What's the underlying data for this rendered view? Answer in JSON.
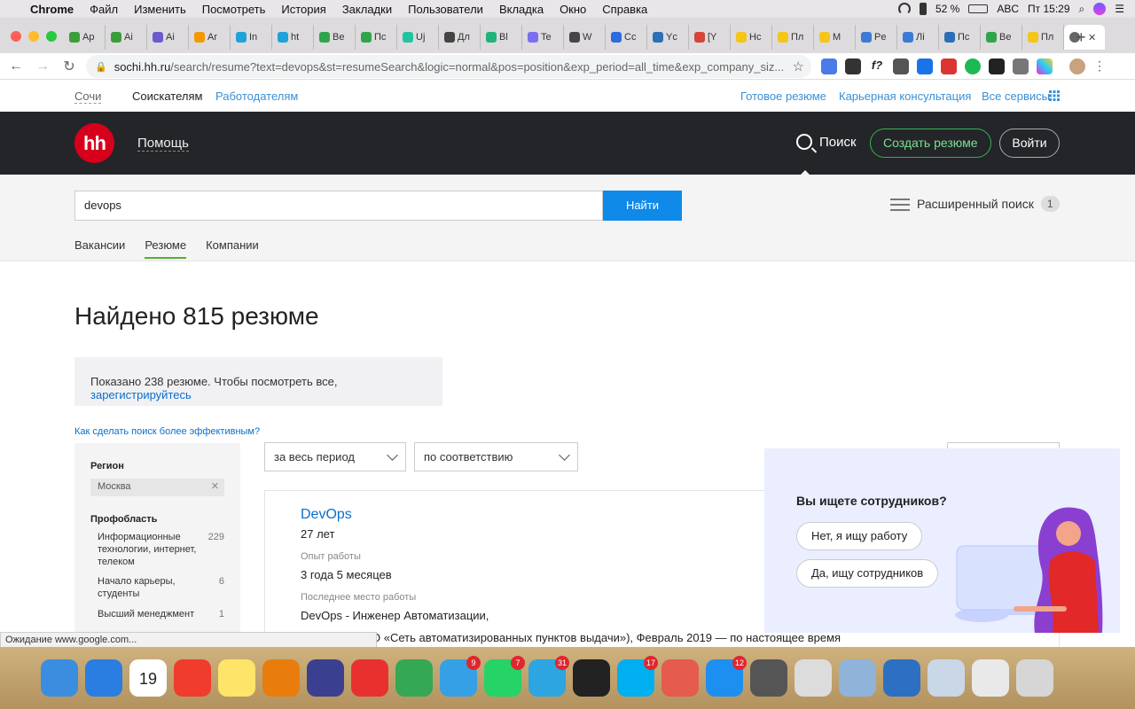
{
  "menubar": {
    "app": "Chrome",
    "items": [
      "Файл",
      "Изменить",
      "Посмотреть",
      "История",
      "Закладки",
      "Пользователи",
      "Вкладка",
      "Окно",
      "Справка"
    ],
    "battery": "52 %",
    "input_source": "ABC",
    "clock": "Пт 15:29"
  },
  "tabs": [
    {
      "label": "Ap",
      "color": "#3a9e3a"
    },
    {
      "label": "Ai",
      "color": "#3a9e3a"
    },
    {
      "label": "Ai",
      "color": "#6a5acd"
    },
    {
      "label": "Ar",
      "color": "#f29900"
    },
    {
      "label": "In",
      "color": "#1ea2d8"
    },
    {
      "label": "ht",
      "color": "#1ea2d8"
    },
    {
      "label": "Be",
      "color": "#2fa54b"
    },
    {
      "label": "Пс",
      "color": "#2fa54b"
    },
    {
      "label": "Uj",
      "color": "#22c4a0"
    },
    {
      "label": "Дл",
      "color": "#444444"
    },
    {
      "label": "Bl",
      "color": "#22b37b"
    },
    {
      "label": "Te",
      "color": "#7a6ff0"
    },
    {
      "label": "W",
      "color": "#464646"
    },
    {
      "label": "Cc",
      "color": "#2d6cdf"
    },
    {
      "label": "Yc",
      "color": "#2c6fb6"
    },
    {
      "label": "[Y",
      "color": "#d44638"
    },
    {
      "label": "Hc",
      "color": "#f5c518"
    },
    {
      "label": "Пл",
      "color": "#f5c518"
    },
    {
      "label": "M",
      "color": "#f5c518"
    },
    {
      "label": "Pe",
      "color": "#3a7bd5"
    },
    {
      "label": "Лi",
      "color": "#3a7bd5"
    },
    {
      "label": "Пс",
      "color": "#2c6fb6"
    },
    {
      "label": "Be",
      "color": "#2fa54b"
    },
    {
      "label": "Пл",
      "color": "#f5c518"
    }
  ],
  "address": {
    "host": "sochi.hh.ru",
    "path": "/search/resume?text=devops&st=resumeSearch&logic=normal&pos=position&exp_period=all_time&exp_company_siz..."
  },
  "sitenav": {
    "city": "Сочи",
    "seekers": "Соискателям",
    "employers": "Работодателям",
    "ready_resume": "Готовое резюме",
    "career": "Карьерная консультация",
    "all_services": "Все сервисы"
  },
  "header": {
    "logo": "hh",
    "help": "Помощь",
    "search": "Поиск",
    "create": "Создать резюме",
    "login": "Войти"
  },
  "search": {
    "query": "devops",
    "button": "Найти",
    "advanced": "Расширенный поиск",
    "advanced_count": "1",
    "tabs": [
      "Вакансии",
      "Резюме",
      "Компании"
    ]
  },
  "results": {
    "found": "Найдено 815 резюме",
    "notice_text": "Показано 238 резюме. Чтобы посмотреть все, ",
    "notice_link": "зарегистрируйтесь",
    "tip": "Как сделать поиск более эффективным?"
  },
  "filters": {
    "region_title": "Регион",
    "region_value": "Москва",
    "prof_title": "Профобласть",
    "prof": [
      {
        "label": "Информационные технологии, интернет, телеком",
        "count": "229"
      },
      {
        "label": "Начало карьеры, студенты",
        "count": "6"
      },
      {
        "label": "Высший менеджмент",
        "count": "1"
      }
    ]
  },
  "sort": {
    "period": "за весь период",
    "order": "по соответствию"
  },
  "resume": {
    "title": "DevOps",
    "age": "27 лет",
    "exp_label": "Опыт работы",
    "exp_value": "3 года 5 месяцев",
    "last_label": "Последнее место работы",
    "last_value": "DevOps - Инженер Автоматизации,",
    "company": "О «Сеть автоматизированных пунктов выдачи»), Февраль 2019 — по настоящее время"
  },
  "popup": {
    "title": "Вы ищете сотрудников?",
    "no": "Нет, я ищу работу",
    "yes": "Да, ищу сотрудников"
  },
  "status_bar": "Ожидание www.google.com...",
  "dock": [
    {
      "name": "finder",
      "color": "#3b8de0"
    },
    {
      "name": "safari",
      "color": "#2a7de1"
    },
    {
      "name": "calendar",
      "color": "#ffffff",
      "text": "19"
    },
    {
      "name": "anydesk",
      "color": "#ef3c2d"
    },
    {
      "name": "notes",
      "color": "#ffe46a"
    },
    {
      "name": "blender",
      "color": "#e87d0d"
    },
    {
      "name": "app-x",
      "color": "#3b3f8f"
    },
    {
      "name": "crossover",
      "color": "#e8312f"
    },
    {
      "name": "chrome",
      "color": "#34a853"
    },
    {
      "name": "24",
      "color": "#35a0e6",
      "badge": "9"
    },
    {
      "name": "whatsapp",
      "color": "#25d366",
      "badge": "7"
    },
    {
      "name": "telegram",
      "color": "#2ca5e0",
      "badge": "31"
    },
    {
      "name": "terminal",
      "color": "#222222"
    },
    {
      "name": "skype",
      "color": "#00aff0",
      "badge": "17"
    },
    {
      "name": "screen",
      "color": "#e55b4d"
    },
    {
      "name": "appstore",
      "color": "#1d8ff0",
      "badge": "12"
    },
    {
      "name": "calculator",
      "color": "#555555"
    },
    {
      "name": "textedit",
      "color": "#dcdcdc"
    },
    {
      "name": "preview",
      "color": "#8fb3d9"
    },
    {
      "name": "bolt",
      "color": "#2d6fc2"
    },
    {
      "name": "mpeg",
      "color": "#c9d7e6"
    },
    {
      "name": "stack",
      "color": "#e9e9e9"
    },
    {
      "name": "trash",
      "color": "#d6d6d6"
    }
  ]
}
